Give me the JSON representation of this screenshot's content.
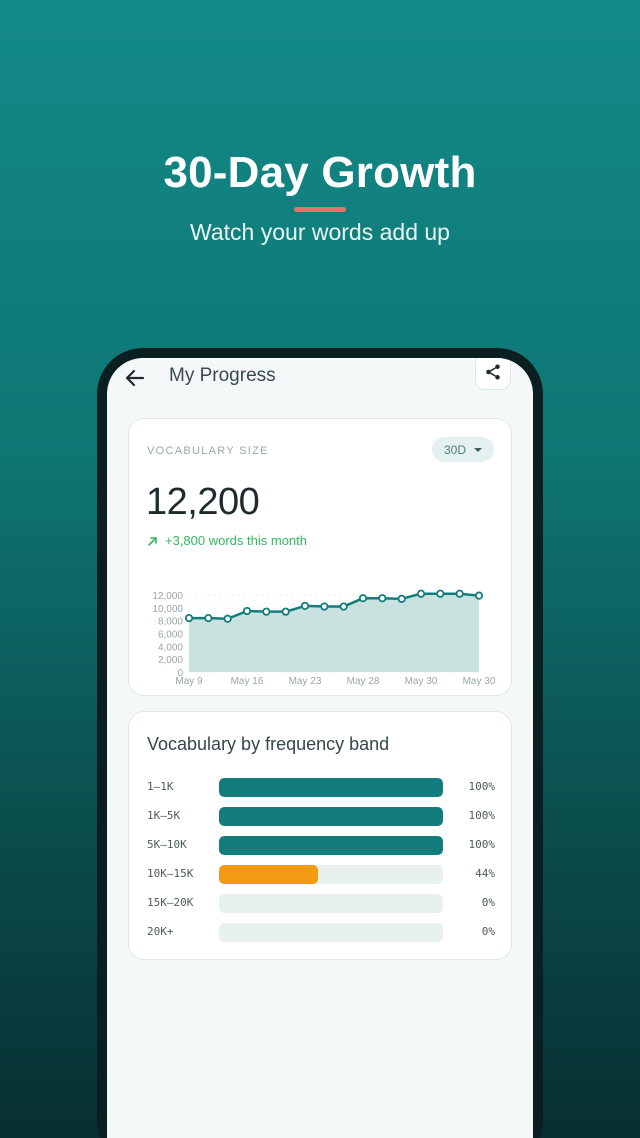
{
  "hero": {
    "title": "30-Day Growth",
    "subtitle": "Watch your words add up",
    "accent_color": "#e8716b"
  },
  "topbar": {
    "title": "My Progress",
    "back_icon": "arrow-left-icon",
    "share_icon": "share-icon"
  },
  "vocab_card": {
    "label": "VOCABULARY SIZE",
    "range": "30D",
    "value": "12,200",
    "delta": "+3,800 words this month",
    "delta_color": "#2fba5c"
  },
  "chart_data": {
    "type": "area",
    "x_tick_labels": [
      "May 9",
      "May 16",
      "May 23",
      "May 28",
      "May 30",
      "May 30"
    ],
    "y_ticks": [
      "0",
      "2,000",
      "4,000",
      "6,000",
      "8,000",
      "10,000",
      "12,000"
    ],
    "ylim": [
      0,
      12000
    ],
    "values": [
      8400,
      8400,
      8300,
      9500,
      9400,
      9400,
      10300,
      10200,
      10200,
      11500,
      11500,
      11400,
      12200,
      12200,
      12200,
      11900
    ],
    "line_color": "#137c7c",
    "fill_color": "#c3dedc"
  },
  "bands_card": {
    "title": "Vocabulary by frequency band",
    "bands": [
      {
        "label": "1–1K",
        "pct_text": "100%",
        "pct": 100,
        "color": "#137c7c"
      },
      {
        "label": "1K–5K",
        "pct_text": "100%",
        "pct": 100,
        "color": "#137c7c"
      },
      {
        "label": "5K–10K",
        "pct_text": "100%",
        "pct": 100,
        "color": "#137c7c"
      },
      {
        "label": "10K–15K",
        "pct_text": "44%",
        "pct": 44,
        "color": "#f29b12"
      },
      {
        "label": "15K–20K",
        "pct_text": "0%",
        "pct": 0,
        "color": "#137c7c"
      },
      {
        "label": "20K+",
        "pct_text": "0%",
        "pct": 0,
        "color": "#137c7c"
      }
    ]
  }
}
